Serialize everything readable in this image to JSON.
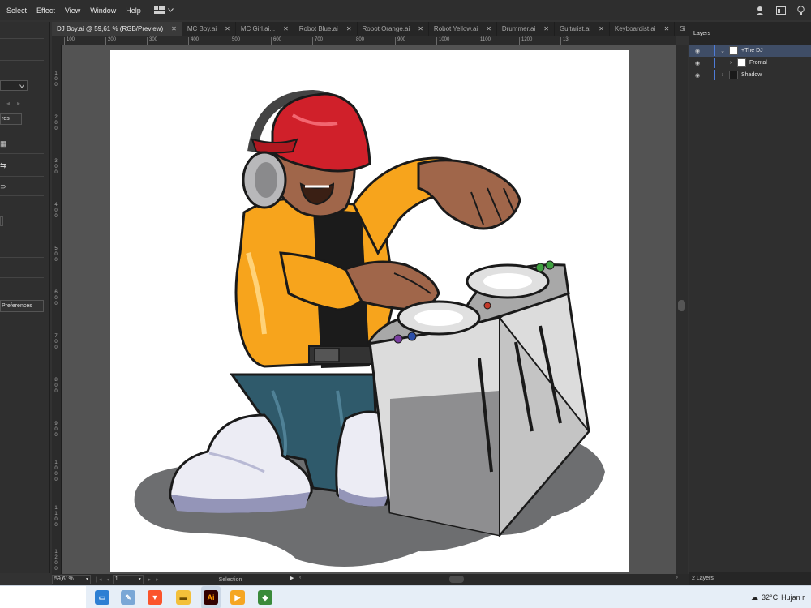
{
  "menu": [
    "Select",
    "Effect",
    "View",
    "Window",
    "Help"
  ],
  "tabs": [
    {
      "label": "DJ Boy.ai @ 59,61 % (RGB/Preview)",
      "active": true
    },
    {
      "label": "MC Boy.ai"
    },
    {
      "label": "MC Girl.ai..."
    },
    {
      "label": "Robot Blue.ai"
    },
    {
      "label": "Robot Orange.ai"
    },
    {
      "label": "Robot Yellow.ai"
    },
    {
      "label": "Drummer.ai"
    },
    {
      "label": "Guitarist.ai"
    },
    {
      "label": "Keyboardist.ai"
    },
    {
      "label": "Si"
    }
  ],
  "tabs_more": ">>",
  "close_glyph": "✕",
  "left_panel": {
    "button1": "rds",
    "preferences": "Preferences"
  },
  "ruler_h": [
    "100",
    "200",
    "300",
    "400",
    "500",
    "600",
    "700",
    "800",
    "900",
    "1000",
    "1100",
    "1200",
    "13"
  ],
  "ruler_v": [
    "1 0 0",
    "2 0 0",
    "3 0 0",
    "4 0 0",
    "5 0 0",
    "6 0 0",
    "7 0 0",
    "8 0 0",
    "9 0 0",
    "1 0 0 0",
    "1 1 0 0",
    "1 2 0 0"
  ],
  "status": {
    "zoom": "59,61%",
    "page": "1",
    "tool": "Selection"
  },
  "layers": {
    "title": "Layers",
    "rows": [
      {
        "name": "+The DJ",
        "selected": true,
        "expanded": true,
        "indent": 0
      },
      {
        "name": "Frontal",
        "selected": false,
        "expanded": false,
        "indent": 1
      },
      {
        "name": "Shadow",
        "selected": false,
        "expanded": false,
        "indent": 0
      }
    ],
    "footer": "2 Layers"
  },
  "taskbar": {
    "temperature": "32°C",
    "weather": "Hujan r",
    "apps": [
      "file-explorer-icon",
      "brave-browser-icon",
      "folder-icon",
      "illustrator-icon",
      "media-player-icon",
      "network-icon"
    ]
  },
  "colors": {
    "accent": "#4e7bd7",
    "illustrator": "#ff9a00",
    "brave": "#fb542b"
  }
}
